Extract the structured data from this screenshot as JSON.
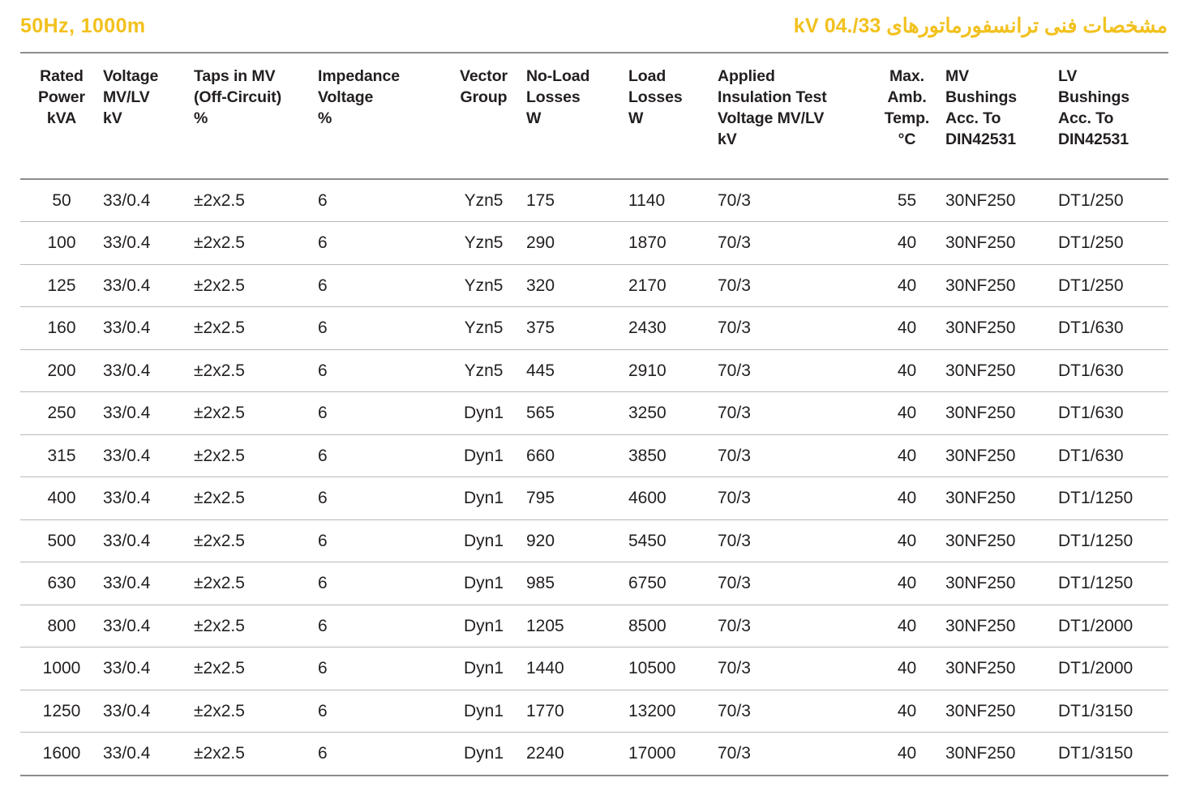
{
  "title": {
    "left": "50Hz,  1000m",
    "right": "مشخصات فنی ترانسفورماتورهای   33/.04 kV",
    "accent_color": "#f2c11e"
  },
  "table": {
    "columns": [
      {
        "key": "rated_power",
        "header": "Rated\nPower\nkVA",
        "align": "center"
      },
      {
        "key": "voltage",
        "header": "Voltage\nMV/LV\nkV",
        "align": "left"
      },
      {
        "key": "taps_mv",
        "header": "Taps in MV\n(Off-Circuit)\n%",
        "align": "left"
      },
      {
        "key": "impedance",
        "header": "Impedance\nVoltage\n%",
        "align": "left"
      },
      {
        "key": "vector_group",
        "header": "Vector\nGroup",
        "align": "center"
      },
      {
        "key": "no_load",
        "header": "No-Load\nLosses\nW",
        "align": "left"
      },
      {
        "key": "load_losses",
        "header": "Load\nLosses\nW",
        "align": "left"
      },
      {
        "key": "applied_test",
        "header": "Applied\nInsulation Test\nVoltage MV/LV\nkV",
        "align": "left"
      },
      {
        "key": "max_temp",
        "header": "Max.\nAmb.\nTemp.\n°C",
        "align": "center"
      },
      {
        "key": "mv_bushings",
        "header": "MV\nBushings\nAcc. To\nDIN42531",
        "align": "left"
      },
      {
        "key": "lv_bushings",
        "header": "LV\nBushings\nAcc. To\nDIN42531",
        "align": "left"
      }
    ],
    "rows": [
      [
        "50",
        "33/0.4",
        "±2x2.5",
        "6",
        "Yzn5",
        "175",
        "1140",
        "70/3",
        "55",
        "30NF250",
        "DT1/250"
      ],
      [
        "100",
        "33/0.4",
        "±2x2.5",
        "6",
        "Yzn5",
        "290",
        "1870",
        "70/3",
        "40",
        "30NF250",
        "DT1/250"
      ],
      [
        "125",
        "33/0.4",
        "±2x2.5",
        "6",
        "Yzn5",
        "320",
        "2170",
        "70/3",
        "40",
        "30NF250",
        "DT1/250"
      ],
      [
        "160",
        "33/0.4",
        "±2x2.5",
        "6",
        "Yzn5",
        "375",
        "2430",
        "70/3",
        "40",
        "30NF250",
        "DT1/630"
      ],
      [
        "200",
        "33/0.4",
        "±2x2.5",
        "6",
        "Yzn5",
        "445",
        "2910",
        "70/3",
        "40",
        "30NF250",
        "DT1/630"
      ],
      [
        "250",
        "33/0.4",
        "±2x2.5",
        "6",
        "Dyn1",
        "565",
        "3250",
        "70/3",
        "40",
        "30NF250",
        "DT1/630"
      ],
      [
        "315",
        "33/0.4",
        "±2x2.5",
        "6",
        "Dyn1",
        "660",
        "3850",
        "70/3",
        "40",
        "30NF250",
        "DT1/630"
      ],
      [
        "400",
        "33/0.4",
        "±2x2.5",
        "6",
        "Dyn1",
        "795",
        "4600",
        "70/3",
        "40",
        "30NF250",
        "DT1/1250"
      ],
      [
        "500",
        "33/0.4",
        "±2x2.5",
        "6",
        "Dyn1",
        "920",
        "5450",
        "70/3",
        "40",
        "30NF250",
        "DT1/1250"
      ],
      [
        "630",
        "33/0.4",
        "±2x2.5",
        "6",
        "Dyn1",
        "985",
        "6750",
        "70/3",
        "40",
        "30NF250",
        "DT1/1250"
      ],
      [
        "800",
        "33/0.4",
        "±2x2.5",
        "6",
        "Dyn1",
        "1205",
        "8500",
        "70/3",
        "40",
        "30NF250",
        "DT1/2000"
      ],
      [
        "1000",
        "33/0.4",
        "±2x2.5",
        "6",
        "Dyn1",
        "1440",
        "10500",
        "70/3",
        "40",
        "30NF250",
        "DT1/2000"
      ],
      [
        "1250",
        "33/0.4",
        "±2x2.5",
        "6",
        "Dyn1",
        "1770",
        "13200",
        "70/3",
        "40",
        "30NF250",
        "DT1/3150"
      ],
      [
        "1600",
        "33/0.4",
        "±2x2.5",
        "6",
        "Dyn1",
        "2240",
        "17000",
        "70/3",
        "40",
        "30NF250",
        "DT1/3150"
      ]
    ]
  }
}
